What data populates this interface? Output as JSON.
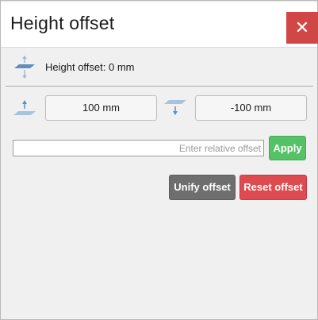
{
  "window": {
    "title": "Height offset",
    "close_glyph": "✕"
  },
  "info": {
    "label": "Height offset: 0 mm",
    "icon": "height-offset-icon"
  },
  "offset_buttons": {
    "up_label": "100 mm",
    "up_icon": "raise-plane-icon",
    "down_label": "-100 mm",
    "down_icon": "lower-plane-icon"
  },
  "relative": {
    "placeholder": "Enter relative offset",
    "value": "",
    "apply_label": "Apply"
  },
  "actions": {
    "unify_label": "Unify offset",
    "reset_label": "Reset offset"
  },
  "colors": {
    "close": "#cf4747",
    "apply": "#55c266",
    "unify": "#6e6e6e",
    "reset": "#dd4a4f",
    "icon": "#7fa6c9"
  }
}
